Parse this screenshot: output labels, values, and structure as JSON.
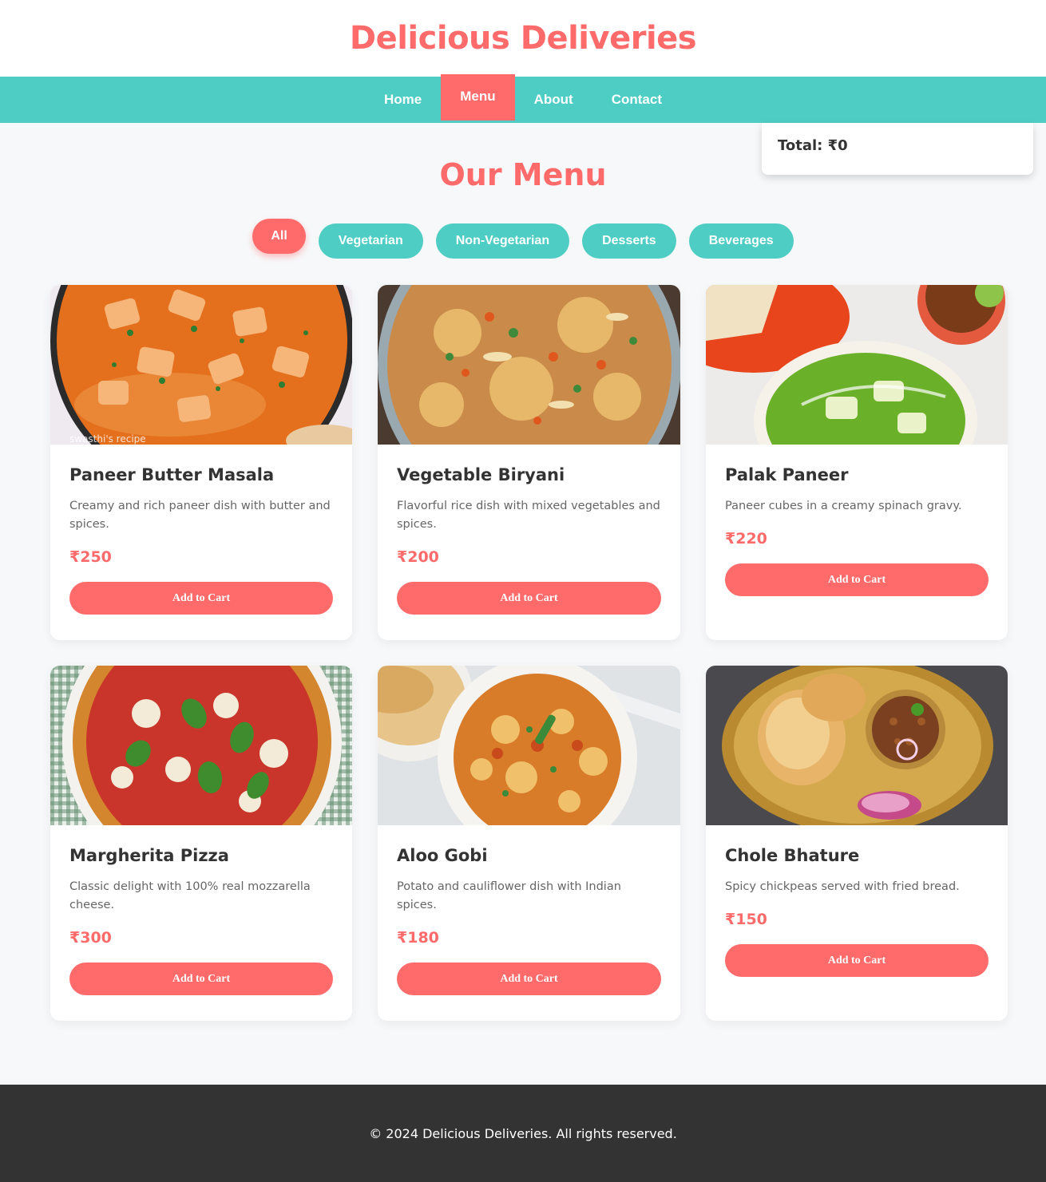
{
  "site": {
    "title": "Delicious Deliveries"
  },
  "nav": {
    "items": [
      {
        "label": "Home"
      },
      {
        "label": "Menu"
      },
      {
        "label": "About"
      },
      {
        "label": "Contact"
      }
    ]
  },
  "cart": {
    "total_label": "Total: ₹0"
  },
  "menu": {
    "title": "Our Menu",
    "filters": [
      "All",
      "Vegetarian",
      "Non-Vegetarian",
      "Desserts",
      "Beverages"
    ],
    "add_label": "Add to Cart",
    "items": [
      {
        "name": "Paneer Butter Masala",
        "description": "Creamy and rich paneer dish with butter and spices.",
        "price": "₹250",
        "overlay": "swasthi's recipe"
      },
      {
        "name": "Vegetable Biryani",
        "description": "Flavorful rice dish with mixed vegetables and spices.",
        "price": "₹200"
      },
      {
        "name": "Palak Paneer",
        "description": "Paneer cubes in a creamy spinach gravy.",
        "price": "₹220"
      },
      {
        "name": "Margherita Pizza",
        "description": "Classic delight with 100% real mozzarella cheese.",
        "price": "₹300"
      },
      {
        "name": "Aloo Gobi",
        "description": "Potato and cauliflower dish with Indian spices.",
        "price": "₹180"
      },
      {
        "name": "Chole Bhature",
        "description": "Spicy chickpeas served with fried bread.",
        "price": "₹150"
      }
    ]
  },
  "footer": {
    "text": "© 2024 Delicious Deliveries. All rights reserved."
  },
  "colors": {
    "accent": "#ff6b6b",
    "teal": "#4ecdc4",
    "footer_bg": "#333333"
  }
}
